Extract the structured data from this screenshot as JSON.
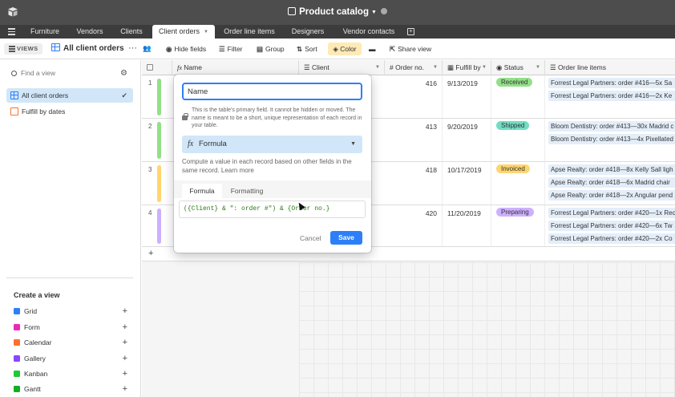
{
  "app": {
    "base_title": "Product catalog"
  },
  "tabs": [
    {
      "label": "Furniture"
    },
    {
      "label": "Vendors"
    },
    {
      "label": "Clients"
    },
    {
      "label": "Client orders",
      "active": true
    },
    {
      "label": "Order line items"
    },
    {
      "label": "Designers"
    },
    {
      "label": "Vendor contacts"
    }
  ],
  "toolbar": {
    "views_label": "VIEWS",
    "view_name": "All client orders",
    "hide_fields": "Hide fields",
    "filter": "Filter",
    "group": "Group",
    "sort": "Sort",
    "color": "Color",
    "share_view": "Share view"
  },
  "sidebar": {
    "find_placeholder": "Find a view",
    "views": [
      {
        "label": "All client orders",
        "active": true,
        "icon_color": "#2d7ff9"
      },
      {
        "label": "Fulfill by dates",
        "active": false,
        "icon_color": "#f82b60"
      }
    ],
    "create_title": "Create a view",
    "create_items": [
      {
        "label": "Grid",
        "icon_color": "#2d7ff9"
      },
      {
        "label": "Form",
        "icon_color": "#e929ba"
      },
      {
        "label": "Calendar",
        "icon_color": "#ff6f2c"
      },
      {
        "label": "Gallery",
        "icon_color": "#8b46ff"
      },
      {
        "label": "Kanban",
        "icon_color": "#20c933"
      },
      {
        "label": "Gantt",
        "icon_color": "#11af22"
      }
    ]
  },
  "grid": {
    "headers": {
      "name": "Name",
      "client": "Client",
      "order_no": "Order no.",
      "fulfill_by": "Fulfill by",
      "status": "Status",
      "line_items": "Order line items"
    },
    "rows": [
      {
        "num": "1",
        "bar_color": "#93e088",
        "order_no": "416",
        "fulfill_by": "9/13/2019",
        "status": "Received",
        "status_color": "#93e088",
        "line_items": [
          "Forrest Legal Partners: order #416—5x Sa",
          "Forrest Legal Partners: order #416—2x Ke"
        ]
      },
      {
        "num": "2",
        "bar_color": "#93e088",
        "order_no": "413",
        "fulfill_by": "9/20/2019",
        "status": "Shipped",
        "status_color": "#72ddc3",
        "line_items": [
          "Bloom Dentistry: order #413—30x Madrid c",
          "Bloom Dentistry: order #413—4x Pixellated"
        ]
      },
      {
        "num": "3",
        "bar_color": "#ffd66e",
        "order_no": "418",
        "fulfill_by": "10/17/2019",
        "status": "Invoiced",
        "status_color": "#ffd66e",
        "line_items": [
          "Apse Realty: order #418—8x Kelly Sall ligh",
          "Apse Realty: order #418—6x Madrid chair",
          "Apse Realty: order #418—2x Angular pend"
        ]
      },
      {
        "num": "4",
        "bar_color": "#cdb0ff",
        "order_no": "420",
        "fulfill_by": "11/20/2019",
        "status": "Preparing",
        "status_color": "#cdb0ff",
        "line_items": [
          "Forrest Legal Partners: order #420—1x Rec",
          "Forrest Legal Partners: order #420—6x Tw",
          "Forrest Legal Partners: order #420—2x Co"
        ]
      }
    ]
  },
  "popup": {
    "field_name": "Name",
    "hint": "This is the table's primary field. It cannot be hidden or moved. The name is meant to be a short, unique representation of each record in your table.",
    "field_type": "Formula",
    "description": "Compute a value in each record based on other fields in the same record. Learn more",
    "tab_formula": "Formula",
    "tab_formatting": "Formatting",
    "formula": "({Client} & \": order #\") & {Order no.}",
    "cancel": "Cancel",
    "save": "Save"
  }
}
